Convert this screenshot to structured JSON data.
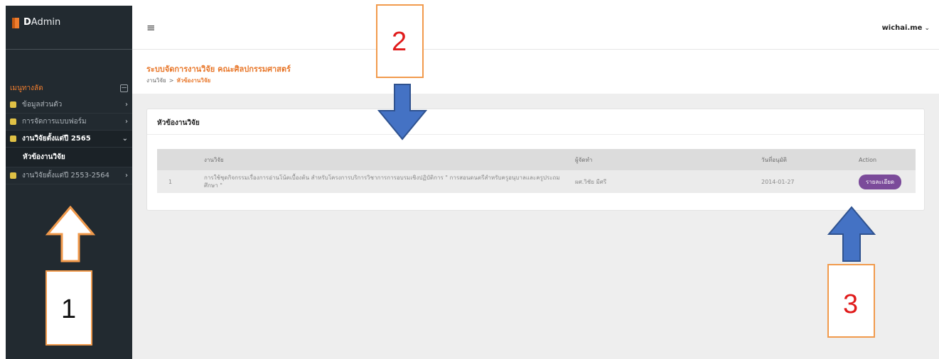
{
  "brand": {
    "logo_icon": "book-icon",
    "name_bold": "D",
    "name_rest": "Admin"
  },
  "sidebar": {
    "menu_heading": "เมนูทางลัด",
    "collapse_icon": "minus-square-icon",
    "items": [
      {
        "label": "ข้อมูลส่วนตัว",
        "icon": "user-icon",
        "chevron": "›"
      },
      {
        "label": "การจัดการแบบฟอร์ม",
        "icon": "folder-icon",
        "chevron": "›"
      },
      {
        "label": "งานวิจัยตั้งแต่ปี 2565",
        "icon": "file-icon",
        "chevron": "⌄"
      },
      {
        "label": "หัวข้องานวิจัย",
        "icon": "",
        "chevron": ""
      },
      {
        "label": "งานวิจัยตั้งแต่ปี 2553-2564",
        "icon": "file-icon",
        "chevron": "›"
      }
    ]
  },
  "topbar": {
    "menu_icon": "≡",
    "user": "wichai.me",
    "caret": "⌄"
  },
  "page": {
    "title": "ระบบจัดการงานวิจัย คณะศิลปกรรมศาสตร์",
    "breadcrumb_root": "งานวิจัย",
    "breadcrumb_sep": ">",
    "breadcrumb_current": "หัวข้องานวิจัย"
  },
  "card": {
    "title": "หัวข้องานวิจัย",
    "columns": [
      "",
      "งานวิจัย",
      "ผู้จัดทำ",
      "วันที่อนุมัติ",
      "Action"
    ],
    "rows": [
      {
        "no": "1",
        "title": "การใช้ชุดกิจกรรมเรื่องการอ่านโน้ตเบื้องต้น สำหรับโครงการบริการวิชาการการอบรมเชิงปฏิบัติการ \" การสอนดนตรีสำหรับครูอนุบาลและครูประถมศึกษา \"",
        "author": "ผศ.วิชัย มีศรี",
        "date": "2014-01-27",
        "action": "รายละเอียด"
      }
    ]
  },
  "annotations": {
    "one": "1",
    "two": "2",
    "three": "3"
  },
  "colors": {
    "accent": "#e8772a",
    "sidebar": "#222a30",
    "button": "#7b4b9a",
    "arrow_blue": "#4472c4",
    "arrow_orange": "#f19a4c"
  }
}
